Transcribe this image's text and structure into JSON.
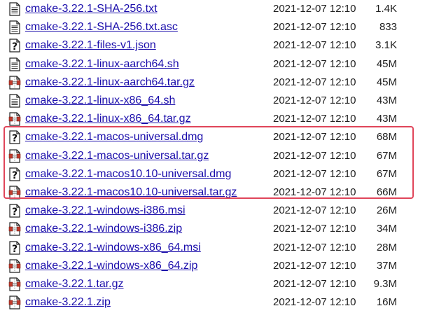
{
  "files": [
    {
      "name": "cmake-3.22.1-SHA-256.txt",
      "date": "2021-12-07 12:10",
      "size": "1.4K",
      "icon": "text-file-icon"
    },
    {
      "name": "cmake-3.22.1-SHA-256.txt.asc",
      "date": "2021-12-07 12:10",
      "size": "833",
      "icon": "text-file-icon"
    },
    {
      "name": "cmake-3.22.1-files-v1.json",
      "date": "2021-12-07 12:10",
      "size": "3.1K",
      "icon": "unknown-file-icon"
    },
    {
      "name": "cmake-3.22.1-linux-aarch64.sh",
      "date": "2021-12-07 12:10",
      "size": "45M",
      "icon": "text-file-icon"
    },
    {
      "name": "cmake-3.22.1-linux-aarch64.tar.gz",
      "date": "2021-12-07 12:10",
      "size": "45M",
      "icon": "archive-file-icon"
    },
    {
      "name": "cmake-3.22.1-linux-x86_64.sh",
      "date": "2021-12-07 12:10",
      "size": "43M",
      "icon": "text-file-icon"
    },
    {
      "name": "cmake-3.22.1-linux-x86_64.tar.gz",
      "date": "2021-12-07 12:10",
      "size": "43M",
      "icon": "archive-file-icon"
    },
    {
      "name": "cmake-3.22.1-macos-universal.dmg",
      "date": "2021-12-07 12:10",
      "size": "68M",
      "icon": "unknown-file-icon"
    },
    {
      "name": "cmake-3.22.1-macos-universal.tar.gz",
      "date": "2021-12-07 12:10",
      "size": "67M",
      "icon": "archive-file-icon"
    },
    {
      "name": "cmake-3.22.1-macos10.10-universal.dmg",
      "date": "2021-12-07 12:10",
      "size": "67M",
      "icon": "unknown-file-icon"
    },
    {
      "name": "cmake-3.22.1-macos10.10-universal.tar.gz",
      "date": "2021-12-07 12:10",
      "size": "66M",
      "icon": "archive-file-icon"
    },
    {
      "name": "cmake-3.22.1-windows-i386.msi",
      "date": "2021-12-07 12:10",
      "size": "26M",
      "icon": "unknown-file-icon"
    },
    {
      "name": "cmake-3.22.1-windows-i386.zip",
      "date": "2021-12-07 12:10",
      "size": "34M",
      "icon": "archive-file-icon"
    },
    {
      "name": "cmake-3.22.1-windows-x86_64.msi",
      "date": "2021-12-07 12:10",
      "size": "28M",
      "icon": "unknown-file-icon"
    },
    {
      "name": "cmake-3.22.1-windows-x86_64.zip",
      "date": "2021-12-07 12:10",
      "size": "37M",
      "icon": "archive-file-icon"
    },
    {
      "name": "cmake-3.22.1.tar.gz",
      "date": "2021-12-07 12:10",
      "size": "9.3M",
      "icon": "archive-file-icon"
    },
    {
      "name": "cmake-3.22.1.zip",
      "date": "2021-12-07 12:10",
      "size": "16M",
      "icon": "archive-file-icon"
    }
  ],
  "highlight_color": "#e0455a",
  "link_color": "#1a0dab"
}
